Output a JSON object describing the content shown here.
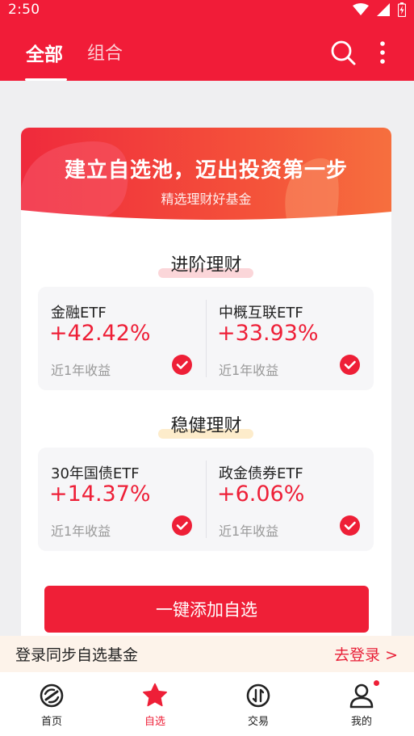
{
  "status": {
    "time": "2:50"
  },
  "nav": {
    "tab_all": "全部",
    "tab_group": "组合"
  },
  "banner": {
    "title": "建立自选池，迈出投资第一步",
    "subtitle": "精选理财好基金"
  },
  "sections": [
    {
      "title": "进阶理财",
      "funds": [
        {
          "name": "金融ETF",
          "return": "+42.42%",
          "label": "近1年收益"
        },
        {
          "name": "中概互联ETF",
          "return": "+33.93%",
          "label": "近1年收益"
        }
      ]
    },
    {
      "title": "稳健理财",
      "funds": [
        {
          "name": "30年国债ETF",
          "return": "+14.37%",
          "label": "近1年收益"
        },
        {
          "name": "政金债券ETF",
          "return": "+6.06%",
          "label": "近1年收益"
        }
      ]
    }
  ],
  "add_button": "一键添加自选",
  "login": {
    "text": "登录同步自选基金",
    "link": "去登录 >"
  },
  "tabbar": [
    {
      "label": "首页",
      "icon": "home-icon"
    },
    {
      "label": "自选",
      "icon": "star-icon"
    },
    {
      "label": "交易",
      "icon": "trade-icon"
    },
    {
      "label": "我的",
      "icon": "profile-icon"
    }
  ],
  "colors": {
    "brand": "#f11c38",
    "accent": "#ee1f37",
    "login_bg": "#fdf3ea"
  }
}
